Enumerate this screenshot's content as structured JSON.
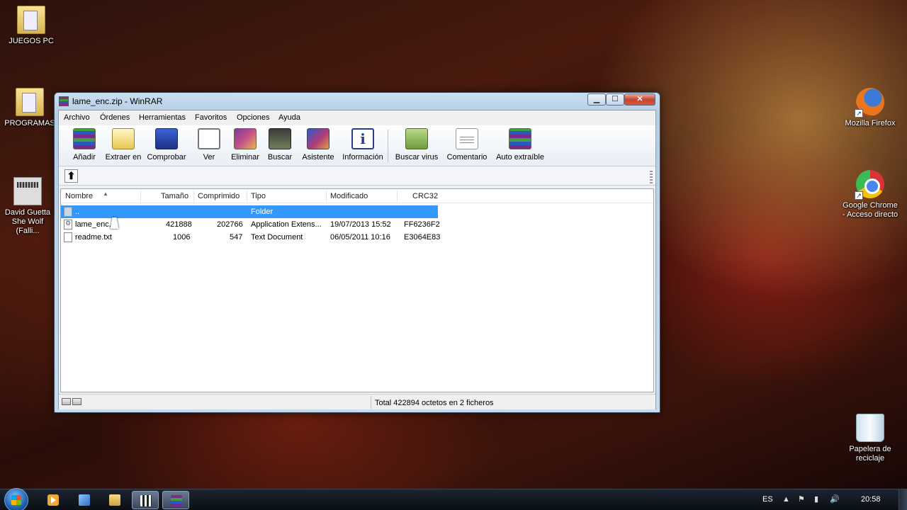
{
  "desktop": {
    "icons": [
      {
        "label": "JUEGOS PC"
      },
      {
        "label": "PROGRAMAS"
      },
      {
        "label": "David Guetta She Wolf (Falli..."
      },
      {
        "label": "Mozilla Firefox"
      },
      {
        "label": "Google Chrome - Acceso directo"
      },
      {
        "label": "Papelera de reciclaje"
      }
    ]
  },
  "window": {
    "title": "lame_enc.zip - WinRAR",
    "controls": {
      "minimize": "▁",
      "maximize": "☐",
      "close": "✕"
    }
  },
  "menu": [
    "Archivo",
    "Órdenes",
    "Herramientas",
    "Favoritos",
    "Opciones",
    "Ayuda"
  ],
  "toolbar": [
    {
      "label": "Añadir",
      "icon": "add-archive-icon"
    },
    {
      "label": "Extraer en",
      "icon": "extract-icon"
    },
    {
      "label": "Comprobar",
      "icon": "test-icon"
    },
    {
      "label": "Ver",
      "icon": "view-icon"
    },
    {
      "label": "Eliminar",
      "icon": "delete-icon"
    },
    {
      "label": "Buscar",
      "icon": "find-icon"
    },
    {
      "label": "Asistente",
      "icon": "wizard-icon"
    },
    {
      "label": "Información",
      "icon": "info-icon"
    },
    {
      "label": "Buscar virus",
      "icon": "virus-scan-icon"
    },
    {
      "label": "Comentario",
      "icon": "comment-icon"
    },
    {
      "label": "Auto extraíble",
      "icon": "sfx-icon"
    }
  ],
  "address": {
    "up_glyph": "⬆"
  },
  "filelist": {
    "columns": {
      "name": "Nombre",
      "size": "Tamaño",
      "packed": "Comprimido",
      "type": "Tipo",
      "modified": "Modificado",
      "crc": "CRC32"
    },
    "rows": [
      {
        "name": "..",
        "size": "",
        "packed": "",
        "type": "Folder",
        "modified": "",
        "crc": ""
      },
      {
        "name": "lame_enc.dll",
        "size": "421888",
        "packed": "202766",
        "type": "Application Extens...",
        "modified": "19/07/2013 15:52",
        "crc": "FF6236F2"
      },
      {
        "name": "readme.txt",
        "size": "1006",
        "packed": "547",
        "type": "Text Document",
        "modified": "06/05/2011 10:16",
        "crc": "E3064E83"
      }
    ],
    "visible_name_row1": "lame_enc.d"
  },
  "status": {
    "text": "Total 422894 octetos en 2 ficheros"
  },
  "taskbar": {
    "language": "ES",
    "time": "20:58"
  },
  "colors": {
    "selection": "#3399ff",
    "close_button": "#c8442f"
  }
}
